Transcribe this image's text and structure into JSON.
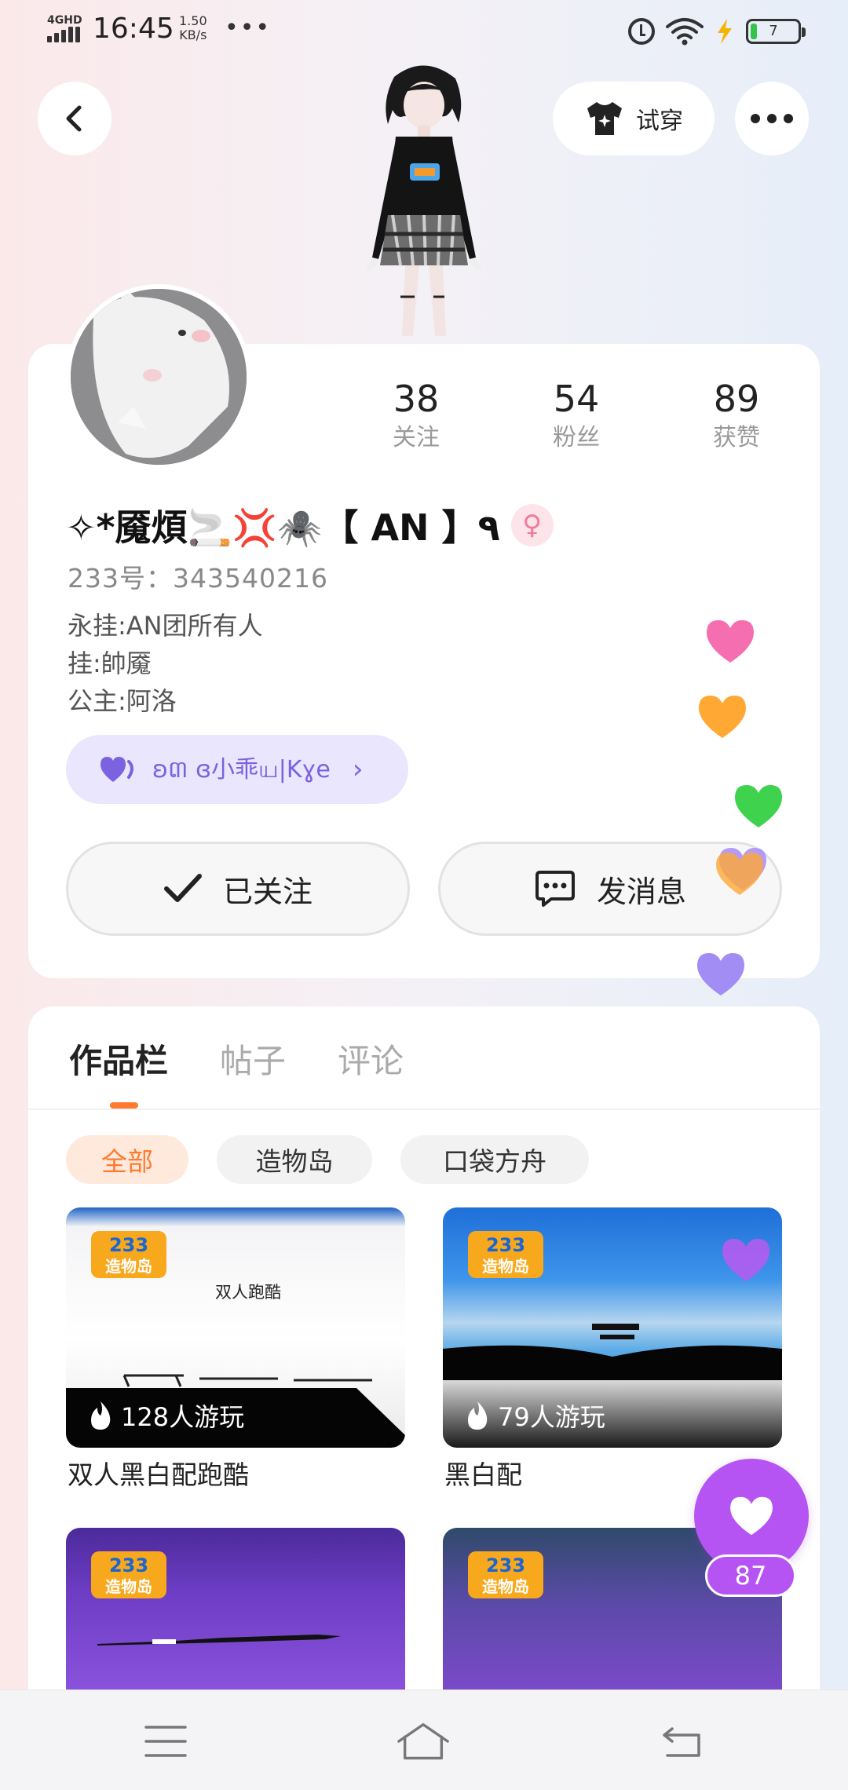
{
  "status_bar": {
    "network": "4GHD",
    "time": "16:45",
    "speed_value": "1.50",
    "speed_unit": "KB/s",
    "more": "•••",
    "battery": "7"
  },
  "header": {
    "tryon_label": "试穿"
  },
  "profile": {
    "stats": [
      {
        "value": "38",
        "label": "关注"
      },
      {
        "value": "54",
        "label": "粉丝"
      },
      {
        "value": "89",
        "label": "获赞"
      }
    ],
    "username": "✧*魇煩🚬💢🕷️【 AN 】٩",
    "gender_icon": "female-icon",
    "uid": "233号：343540216",
    "bio": [
      "永挂:AN团所有人",
      "挂:帥魇",
      "公主:阿洛"
    ],
    "badge_text": "ʚ៣ ɞ小乖ய|Kɣe",
    "follow_label": "已关注",
    "message_label": "发消息"
  },
  "works": {
    "tabs": [
      "作品栏",
      "帖子",
      "评论"
    ],
    "active_tab": 0,
    "chips": [
      "全部",
      "造物岛",
      "口袋方舟"
    ],
    "active_chip": 0,
    "items": [
      {
        "title": "双人黑白配跑酷",
        "plays": "128人游玩",
        "scene_text": "双人跑酷",
        "logo": "233造物岛"
      },
      {
        "title": "黑白配",
        "plays": "79人游玩",
        "scene_text": "",
        "logo": "233造物岛"
      },
      {
        "title": "",
        "plays": "",
        "scene_text": "",
        "logo": "233造物岛"
      },
      {
        "title": "",
        "plays": "",
        "scene_text": "",
        "logo": "233造物岛"
      }
    ]
  },
  "like_fab": {
    "count": "87"
  },
  "colors": {
    "accent_orange": "#ff7a2e",
    "like_purple": "#b554f2",
    "badge_bg": "#e9e6fd"
  }
}
